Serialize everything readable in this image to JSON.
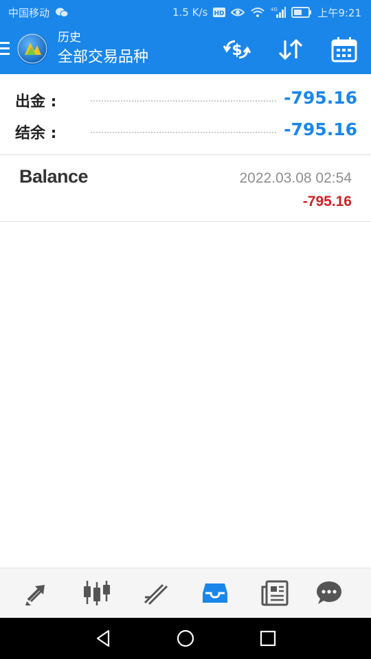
{
  "status_bar": {
    "carrier": "中国移动",
    "net_speed": "1.5 K/s",
    "network_type": "4G",
    "time": "上午9:21",
    "icons": [
      "wechat-icon",
      "hd-icon",
      "eye-icon",
      "wifi-icon",
      "signal-icon",
      "battery-icon"
    ]
  },
  "app_bar": {
    "subtitle": "历史",
    "title": "全部交易品种",
    "actions": [
      "currency-exchange-icon",
      "sort-icon",
      "calendar-icon"
    ]
  },
  "summary": {
    "rows": [
      {
        "label": "出金 :",
        "value": "-795.16"
      },
      {
        "label": "结余 :",
        "value": "-795.16"
      }
    ]
  },
  "history": [
    {
      "type": "Balance",
      "datetime": "2022.03.08 02:54",
      "amount": "-795.16"
    }
  ],
  "tabs": [
    "trade-icon",
    "chart-icon",
    "quotes-trend-icon",
    "history-inbox-icon",
    "news-icon",
    "chat-icon"
  ],
  "active_tab": "history-inbox-icon",
  "colors": {
    "primary": "#1a86ea",
    "value_blue": "#1a86ea",
    "loss_red": "#d21f1f",
    "tab_icon": "#555555"
  }
}
